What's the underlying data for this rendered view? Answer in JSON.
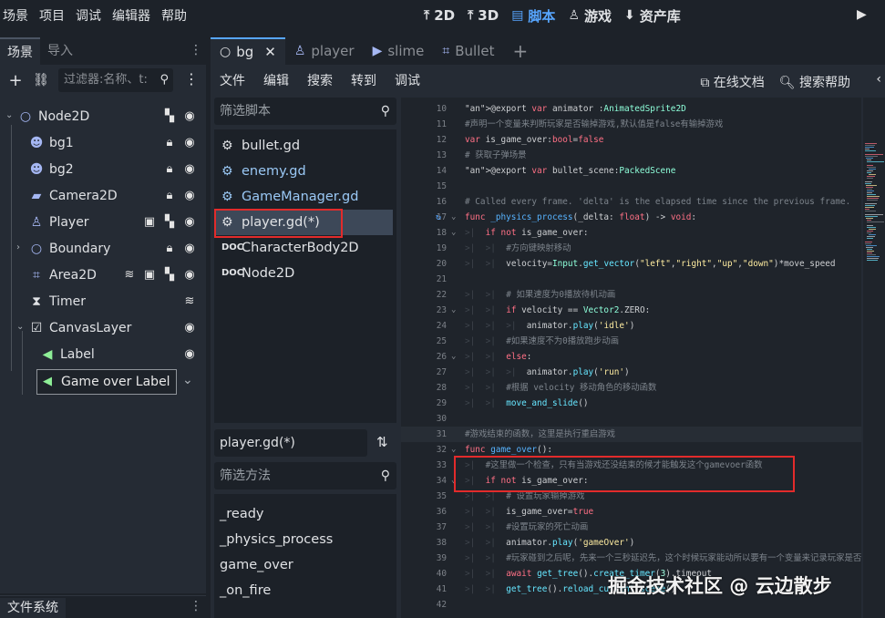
{
  "menu": [
    "场景",
    "项目",
    "调试",
    "编辑器",
    "帮助"
  ],
  "workspaces": [
    {
      "label": "2D",
      "icon": "2d-icon"
    },
    {
      "label": "3D",
      "icon": "3d-icon"
    },
    {
      "label": "脚本",
      "icon": "script-icon"
    },
    {
      "label": "游戏",
      "icon": "game-icon"
    },
    {
      "label": "资产库",
      "icon": "assetlib-icon"
    }
  ],
  "scene_dock": {
    "tabs": [
      "场景",
      "导入"
    ],
    "filter_placeholder": "过滤器:名称、t:",
    "nodes": [
      {
        "label": "Node2D"
      },
      {
        "label": "bg1"
      },
      {
        "label": "bg2"
      },
      {
        "label": "Camera2D"
      },
      {
        "label": "Player"
      },
      {
        "label": "Boundary"
      },
      {
        "label": "Area2D"
      },
      {
        "label": "Timer"
      },
      {
        "label": "CanvasLayer"
      },
      {
        "label": "Label"
      },
      {
        "label": "Game over Label"
      }
    ]
  },
  "filesystem_dock": {
    "tab": "文件系统"
  },
  "script_tabs": [
    "bg",
    "player",
    "slime",
    "Bullet"
  ],
  "script_menu": [
    "文件",
    "编辑",
    "搜索",
    "转到",
    "调试"
  ],
  "script_menu_right": [
    "在线文档",
    "搜索帮助"
  ],
  "script_filter_placeholder": "筛选脚本",
  "scripts": [
    "bullet.gd",
    "enemy.gd",
    "GameManager.gd",
    "player.gd(*)",
    "CharacterBody2D",
    "Node2D"
  ],
  "current_file": "player.gd(*)",
  "method_filter_placeholder": "筛选方法",
  "methods": [
    "_ready",
    "_physics_process",
    "game_over",
    "_on_fire"
  ],
  "code": {
    "line_numbers": [
      "10",
      "11",
      "12",
      "13",
      "14",
      "15",
      "16",
      "17",
      "18",
      "19",
      "20",
      "21",
      "22",
      "23",
      "24",
      "25",
      "26",
      "27",
      "28",
      "29",
      "30",
      "31",
      "32",
      "33",
      "34",
      "35",
      "36",
      "37",
      "38",
      "39",
      "40",
      "41",
      "42"
    ],
    "lines": [
      "@export var animator :AnimatedSprite2D",
      "#声明一个变量来判断玩家是否输掉游戏,默认值是false有输掉游戏",
      "var is_game_over:bool=false",
      "# 获取子弹场景",
      "@export var bullet_scene:PackedScene",
      "",
      "# Called every frame. 'delta' is the elapsed time since the previous frame.",
      "func _physics_process(_delta: float) -> void:",
      "    if not is_game_over:",
      "        #方向键映射移动",
      "        velocity=Input.get_vector(\"left\",\"right\",\"up\",\"down\")*move_speed",
      "",
      "        # 如果速度为0播放待机动画",
      "        if velocity == Vector2.ZERO:",
      "            animator.play('idle')",
      "        #如果速度不为0播放跑步动画",
      "        else:",
      "            animator.play('run')",
      "        #根据 velocity 移动角色的移动函数",
      "        move_and_slide()",
      "",
      "#游戏结束的函数，这里是执行重启游戏",
      "func game_over():",
      "    #这里做一个检查，只有当游戏还没结束的候才能触发这个gamevoer函数",
      "    if not is_game_over:",
      "        # 设置玩家输掉游戏",
      "        is_game_over=true",
      "        #设置玩家的死亡动画",
      "        animator.play('gameOver')",
      "        #玩家碰到之后呢，先来一个三秒延迟先，这个时候玩家能动所以要有一个变量来记录玩家是否输掉",
      "        await get_tree().create_timer(3).timeout",
      "        get_tree().reload_current_scene()",
      ""
    ]
  },
  "watermark": "掘金技术社区 @ 云边散步",
  "colors": {
    "accent": "#57a6ff",
    "highlight_box": "#e22b2b",
    "keyword": "#ff7085",
    "comment": "#7d848c"
  }
}
